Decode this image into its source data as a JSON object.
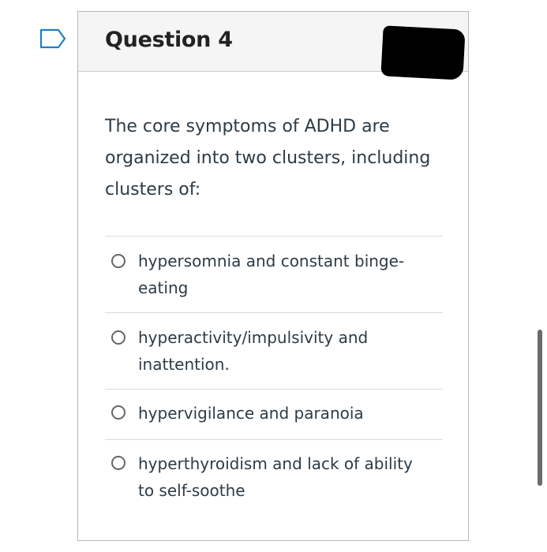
{
  "question": {
    "title": "Question 4",
    "text": "The core symptoms of ADHD are organized into two clusters, including clusters of:"
  },
  "answers": [
    {
      "label": "hypersomnia and constant binge-eating",
      "selected": false
    },
    {
      "label": "hyperactivity/impulsivity and inattention.",
      "selected": false
    },
    {
      "label": "hypervigilance and paranoia",
      "selected": false
    },
    {
      "label": "hyperthyroidism and lack of ability to self-soothe",
      "selected": false
    }
  ],
  "icons": {
    "flag": "flag-icon",
    "radio": "radio-icon"
  },
  "colors": {
    "flag_outline": "#1f7ec2",
    "text": "#2d3b45",
    "header_bg": "#f5f5f5"
  }
}
